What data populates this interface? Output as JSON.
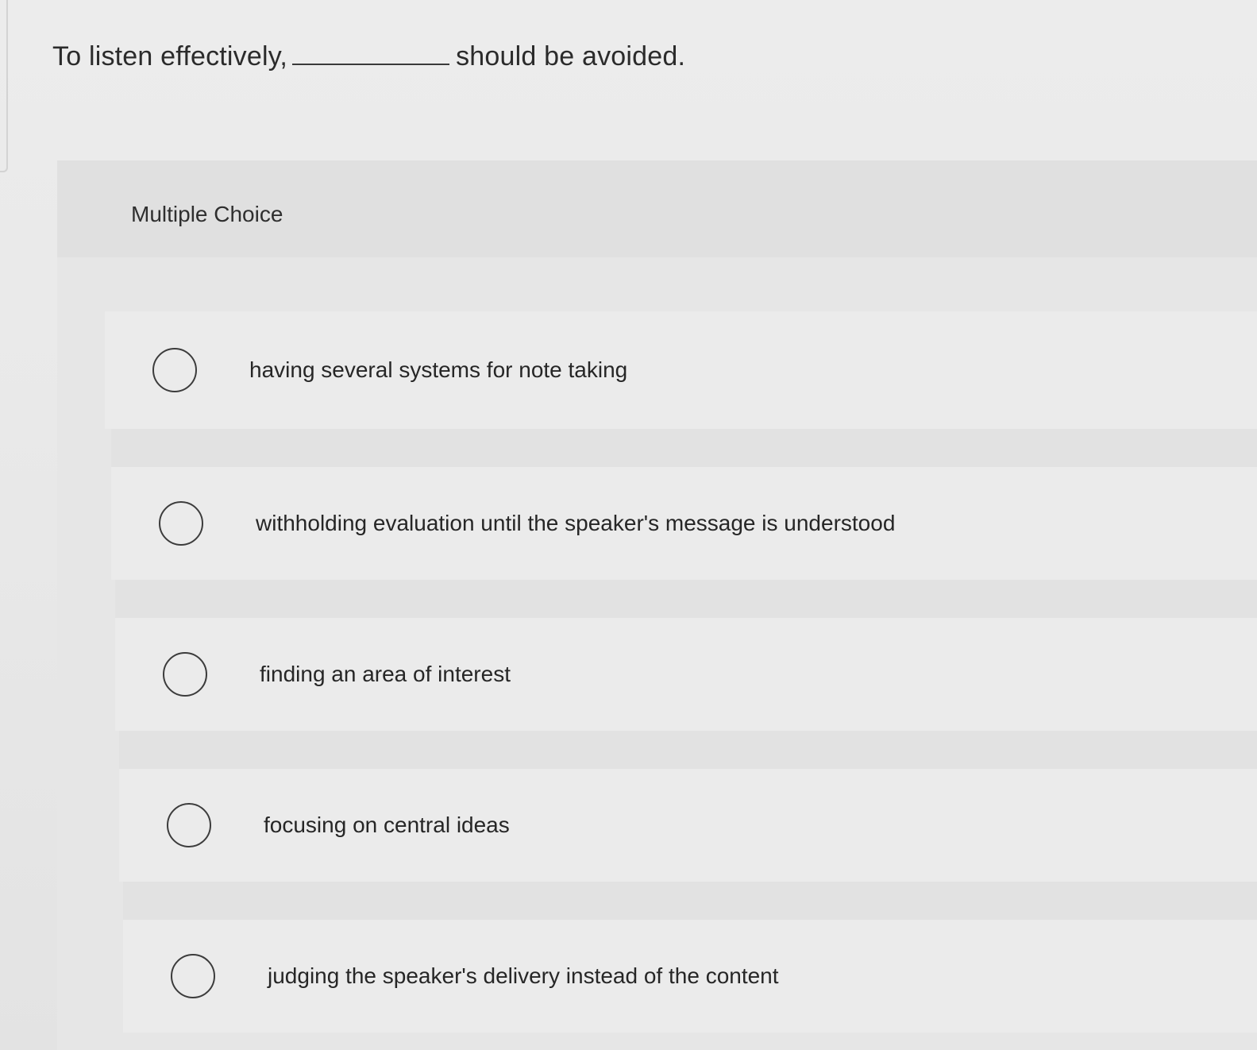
{
  "question": {
    "prefix": "To listen effectively,",
    "suffix": "should be avoided."
  },
  "section": {
    "label": "Multiple Choice"
  },
  "choices": [
    {
      "label": "having several systems for note taking",
      "selected": false
    },
    {
      "label": "withholding evaluation until the speaker's message is understood",
      "selected": false
    },
    {
      "label": "finding an area of interest",
      "selected": false
    },
    {
      "label": "focusing on central ideas",
      "selected": false
    },
    {
      "label": "judging the speaker's delivery instead of the content",
      "selected": false
    }
  ],
  "icons": {
    "radio": "radio-unselected-icon"
  }
}
